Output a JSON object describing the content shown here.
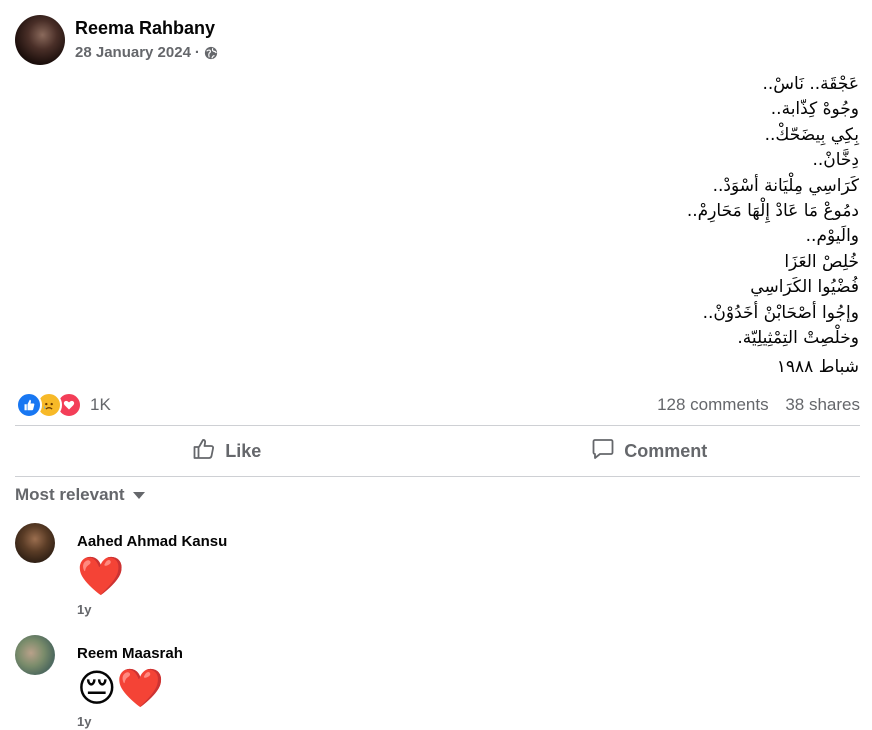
{
  "post": {
    "author": "Reema Rahbany",
    "date": "28 January 2024",
    "privacy_icon": "globe-icon",
    "lines": [
      "عَجْقَة.. نَاسْ..",
      "وجُوهْ كِذّابة..",
      "بِكِي بِيضَحّكْ..",
      "دِخَّانْ..",
      "كَرَاسِي مِلْيَانة أسْوَدْ..",
      "دمُوعْ مَا عَادْ إِلْهَا مَحَارِمْ..",
      "والَيوْم..",
      "خُلِصْ العَزَا",
      "فُضْيُوا الكَرَاسِي",
      "وإجُوا أصْحَابْنْ أخَدُوْنْ..",
      "وخلْصِتْ التِمْثِيلِيّة."
    ],
    "signature": "شباط ١٩٨٨"
  },
  "stats": {
    "reaction_icons": [
      "like-icon",
      "sad-icon",
      "love-icon"
    ],
    "reaction_count": "1K",
    "comments": "128 comments",
    "shares": "38 shares"
  },
  "actions": {
    "like_label": "Like",
    "comment_label": "Comment"
  },
  "comments_section": {
    "filter_label": "Most relevant",
    "items": [
      {
        "name": "Aahed Ahmad Kansu",
        "text": "❤️",
        "time": "1y"
      },
      {
        "name": "Reem Maasrah",
        "text": "😔❤️",
        "time": "1y"
      }
    ]
  },
  "colors": {
    "secondary_text": "#65676b",
    "like_blue": "#1877f2",
    "love_red": "#f33e58",
    "sad_yellow": "#f7b928",
    "divider": "#ced0d4"
  }
}
